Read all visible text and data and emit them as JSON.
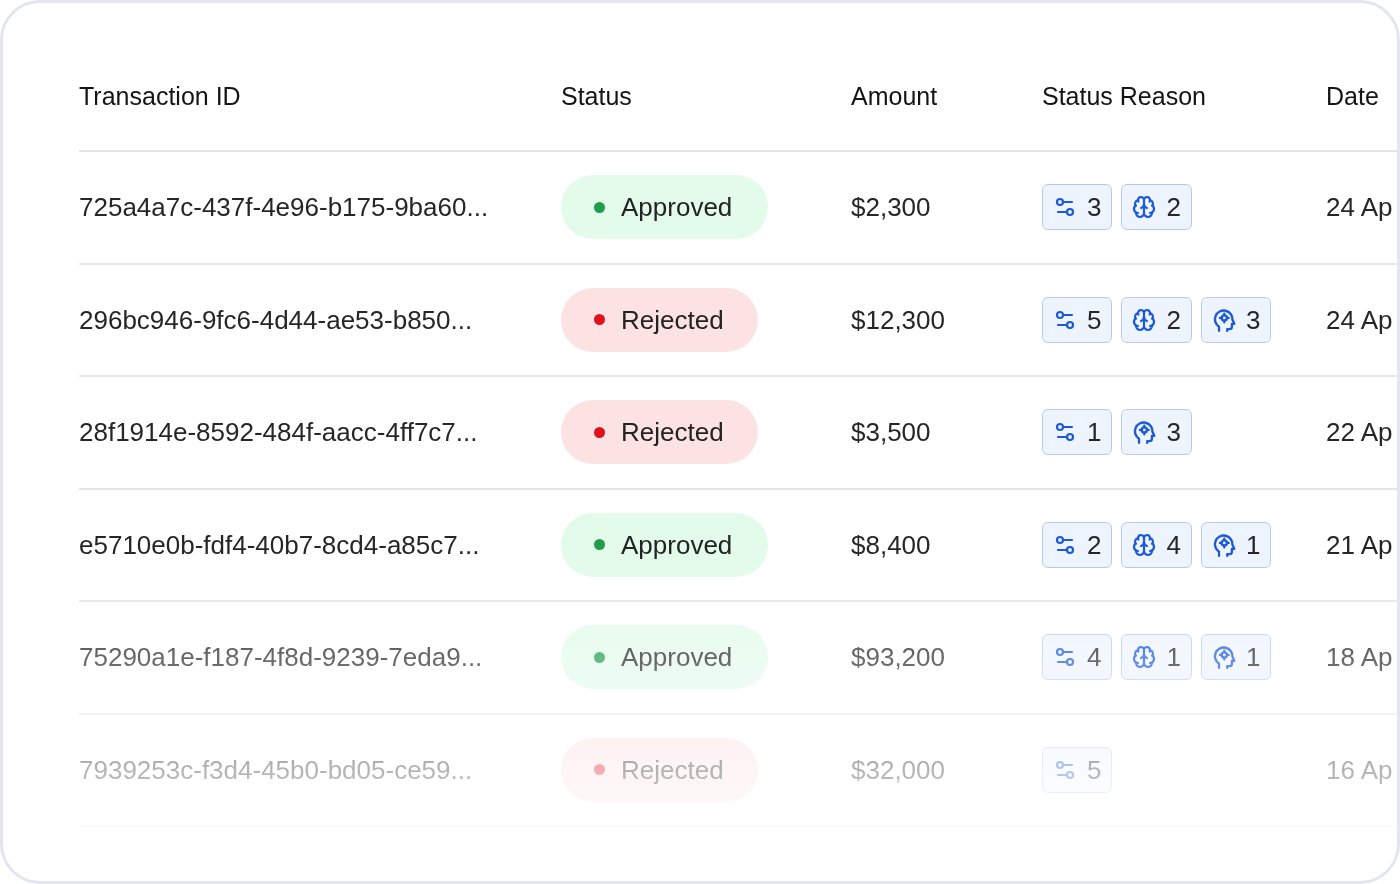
{
  "table": {
    "columns": [
      "Transaction ID",
      "Status",
      "Amount",
      "Status Reason",
      "Date"
    ],
    "rows": [
      {
        "transaction_id": "725a4a7c-437f-4e96-b175-9ba60...",
        "status": {
          "kind": "approved",
          "label": "Approved"
        },
        "amount": "$2,300",
        "reasons": [
          {
            "kind": "sliders",
            "count": "3"
          },
          {
            "kind": "brain",
            "count": "2"
          }
        ],
        "date": "24 Ap"
      },
      {
        "transaction_id": "296bc946-9fc6-4d44-ae53-b850...",
        "status": {
          "kind": "rejected",
          "label": "Rejected"
        },
        "amount": "$12,300",
        "reasons": [
          {
            "kind": "sliders",
            "count": "5"
          },
          {
            "kind": "brain",
            "count": "2"
          },
          {
            "kind": "head",
            "count": "3"
          }
        ],
        "date": "24 Ap"
      },
      {
        "transaction_id": "28f1914e-8592-484f-aacc-4ff7c7...",
        "status": {
          "kind": "rejected",
          "label": "Rejected"
        },
        "amount": "$3,500",
        "reasons": [
          {
            "kind": "sliders",
            "count": "1"
          },
          {
            "kind": "head",
            "count": "3"
          }
        ],
        "date": "22 Ap"
      },
      {
        "transaction_id": "e5710e0b-fdf4-40b7-8cd4-a85c7...",
        "status": {
          "kind": "approved",
          "label": "Approved"
        },
        "amount": "$8,400",
        "reasons": [
          {
            "kind": "sliders",
            "count": "2"
          },
          {
            "kind": "brain",
            "count": "4"
          },
          {
            "kind": "head",
            "count": "1"
          }
        ],
        "date": "21 Ap"
      },
      {
        "transaction_id": "75290a1e-f187-4f8d-9239-7eda9...",
        "status": {
          "kind": "approved",
          "label": "Approved"
        },
        "amount": "$93,200",
        "reasons": [
          {
            "kind": "sliders",
            "count": "4"
          },
          {
            "kind": "brain",
            "count": "1"
          },
          {
            "kind": "head",
            "count": "1"
          }
        ],
        "date": "18 Ap"
      },
      {
        "transaction_id": "7939253c-f3d4-45b0-bd05-ce59...",
        "status": {
          "kind": "rejected",
          "label": "Rejected"
        },
        "amount": "$32,000",
        "reasons": [
          {
            "kind": "sliders",
            "count": "5"
          }
        ],
        "date": "16 Ap"
      }
    ]
  }
}
